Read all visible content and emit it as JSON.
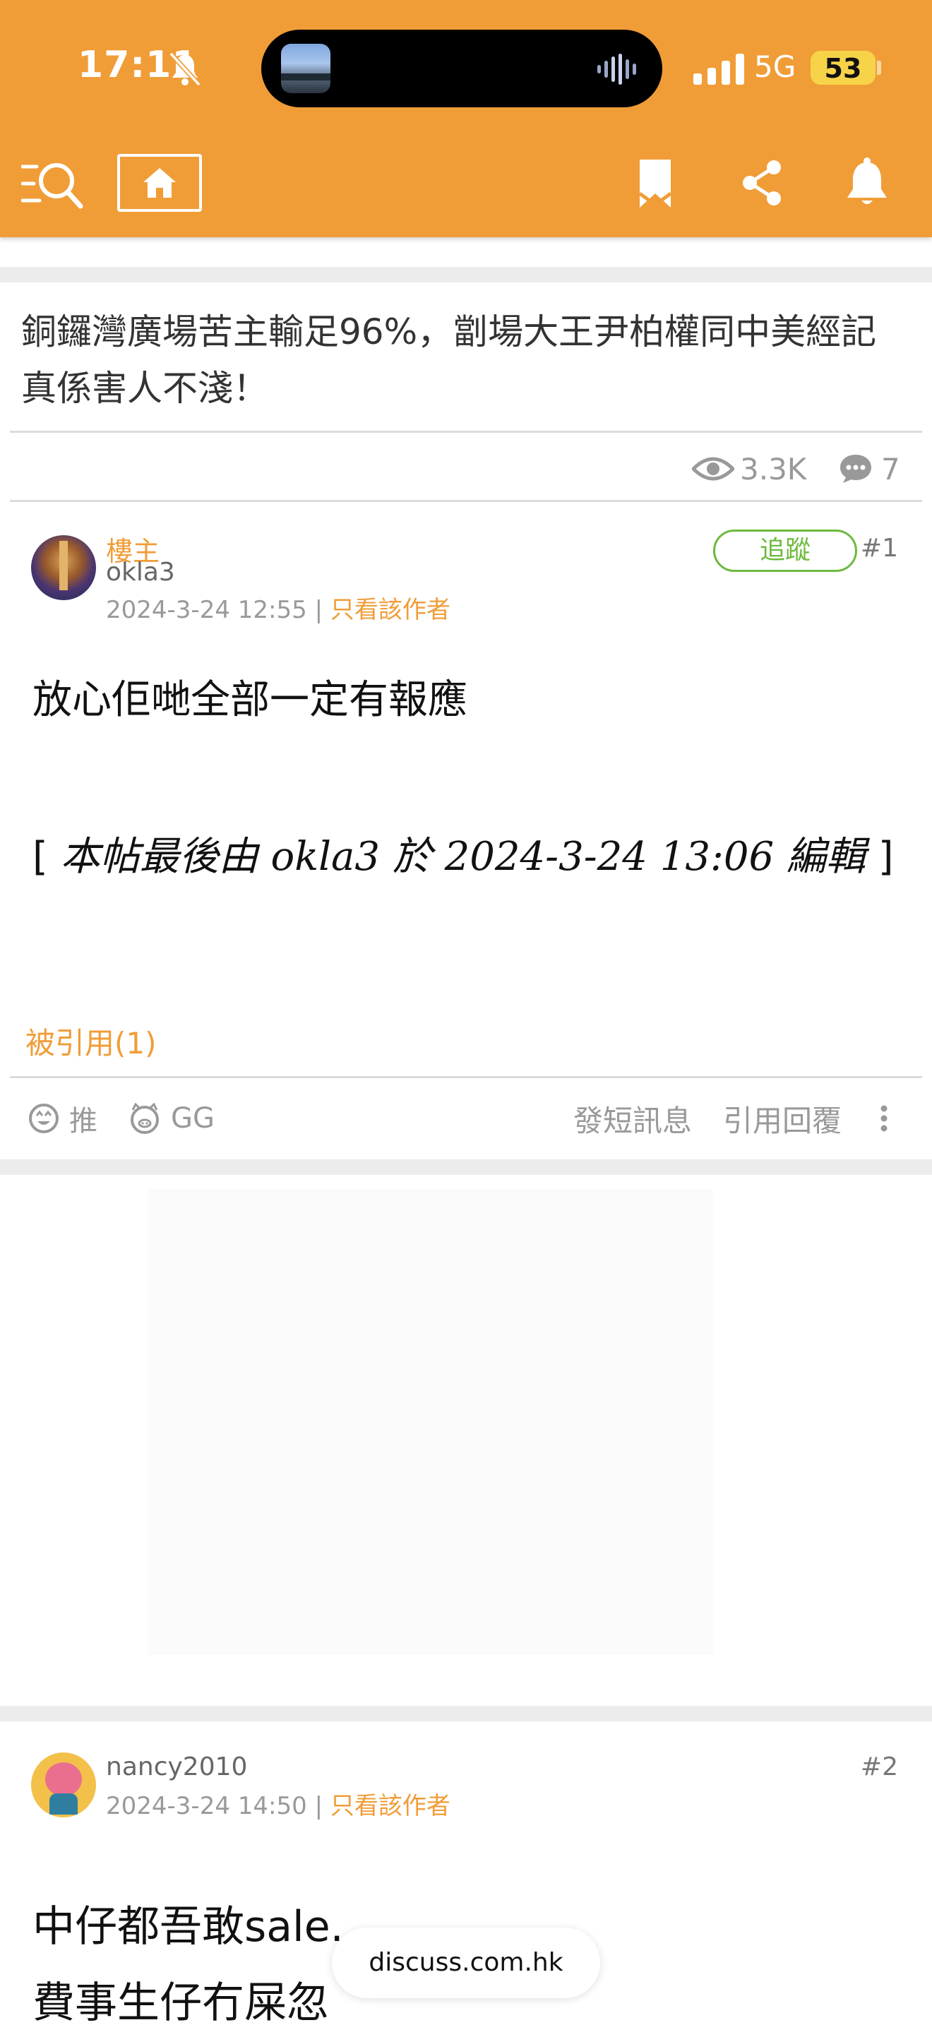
{
  "status_bar": {
    "time": "17:11",
    "network": "5G",
    "battery": "53"
  },
  "toolbar": {
    "icons": [
      "menu-search-icon",
      "home-icon",
      "bookmark-icon",
      "share-icon",
      "notification-bell-icon"
    ]
  },
  "thread": {
    "title": "銅鑼灣廣場苦主輸足96%，劏場大王尹柏權同中美經記真係害人不淺！",
    "views": "3.3K",
    "replies": "7"
  },
  "posts": [
    {
      "op_label": "樓主",
      "username": "okla3",
      "date": "2024-3-24 12:55",
      "separator": "|",
      "author_only": "只看該作者",
      "follow": "追蹤",
      "floor": "#1",
      "body": "放心佢哋全部一定有報應",
      "edit_open": "[",
      "edit_text": "本帖最後由 okla3 於 2024-3-24 13:06 編輯",
      "edit_close": "]",
      "cited": "被引用(1)",
      "actions": {
        "push": "推",
        "gg": "GG",
        "message": "發短訊息",
        "quote": "引用回覆"
      }
    },
    {
      "username": "nancy2010",
      "date": "2024-3-24 14:50",
      "separator": "|",
      "author_only": "只看該作者",
      "floor": "#2",
      "body_lines": [
        "中仔都吾敢sale...",
        "費事生仔冇屎忽"
      ]
    }
  ],
  "browser": {
    "domain": "discuss.com.hk"
  },
  "colors": {
    "brand_orange": "#F09D38",
    "follow_green": "#6DBA3E",
    "battery_yellow": "#F7D349"
  }
}
